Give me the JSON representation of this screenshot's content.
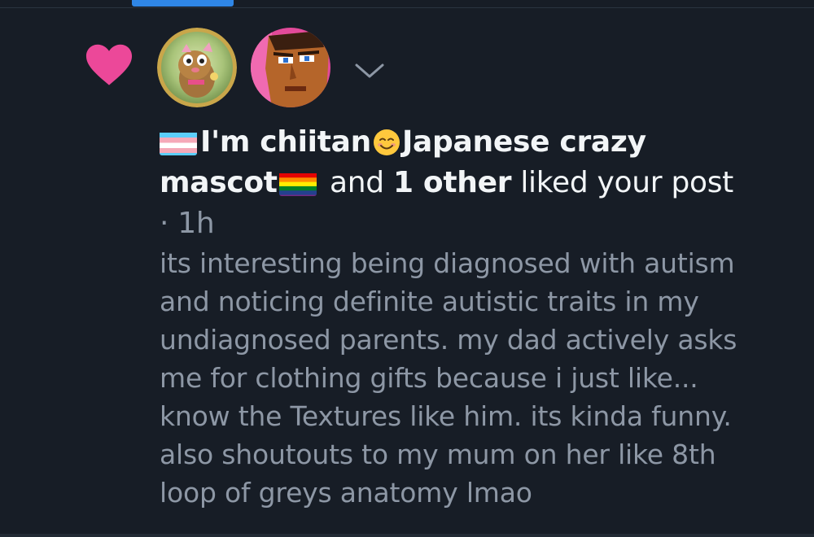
{
  "notification": {
    "actor_name_part1": "I'm chiitan",
    "actor_name_part2": "Japanese crazy",
    "actor_name_part3": "mascot",
    "and_text": "and",
    "others_count_text": "1 other",
    "action_text": "liked your post",
    "timestamp": "· 1h",
    "icons": {
      "reaction": "heart-icon",
      "expand": "chevron-down-icon",
      "flag1": "transgender-flag-icon",
      "emoji": "smiling-face-emoji-icon",
      "flag2": "rainbow-flag-icon"
    },
    "colors": {
      "heart": "#ec4899",
      "background": "#171d26",
      "primary_text": "#f2f5f7",
      "secondary_text": "#8d97a5",
      "tab_indicator": "#2f86e6"
    }
  },
  "post": {
    "lines": [
      "its interesting being diagnosed with autism",
      "and noticing definite autistic traits in my",
      "undiagnosed parents. my dad actively asks",
      "me for clothing gifts because i just like...",
      "know the Textures like him. its kinda funny.",
      "also shoutouts to my mum on her like 8th",
      "loop of greys anatomy lmao"
    ]
  }
}
